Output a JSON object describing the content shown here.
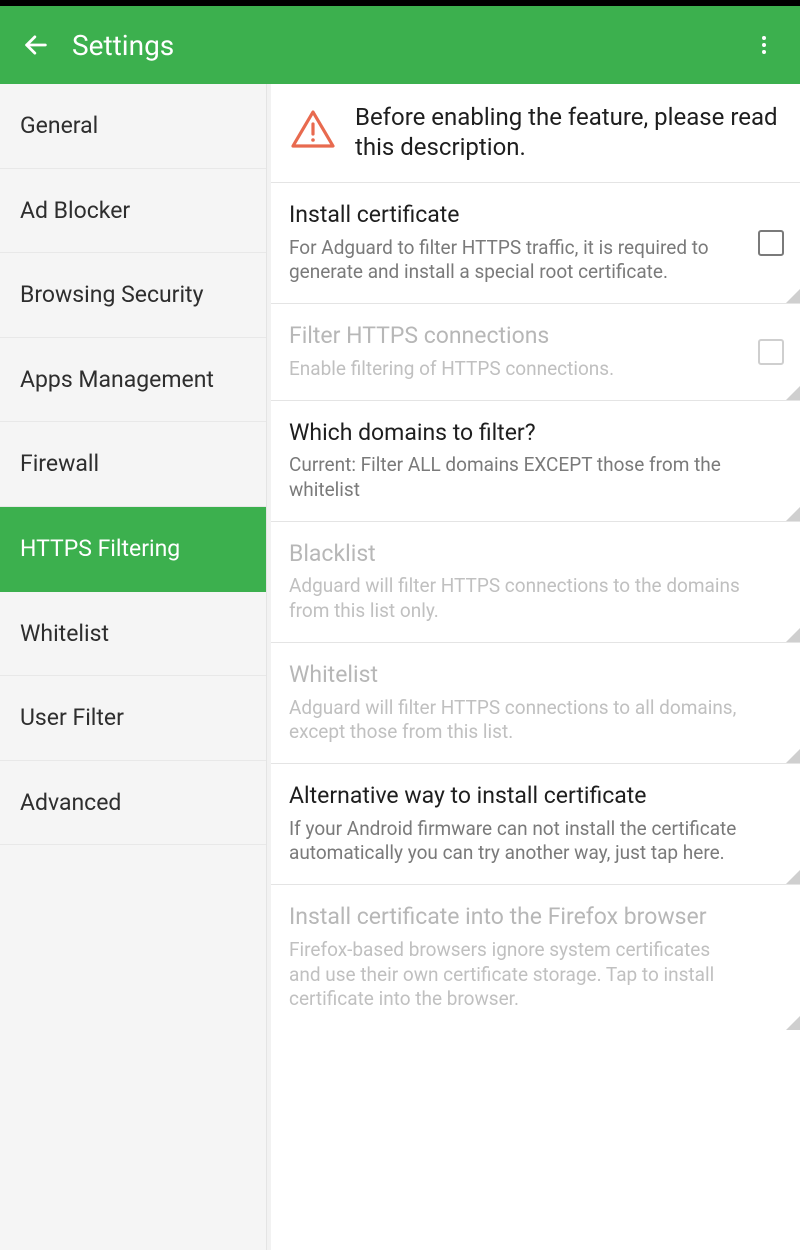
{
  "appbar": {
    "title": "Settings"
  },
  "sidebar": {
    "items": [
      {
        "label": "General"
      },
      {
        "label": "Ad Blocker"
      },
      {
        "label": "Browsing Security"
      },
      {
        "label": "Apps Management"
      },
      {
        "label": "Firewall"
      },
      {
        "label": "HTTPS Filtering"
      },
      {
        "label": "Whitelist"
      },
      {
        "label": "User Filter"
      },
      {
        "label": "Advanced"
      }
    ],
    "activeIndex": 5
  },
  "banner": {
    "message": "Before enabling the feature, please read this description."
  },
  "settings": [
    {
      "title": "Install certificate",
      "desc": "For Adguard to filter HTTPS traffic, it is required to generate and install a special root certificate.",
      "checkbox": true,
      "disabled": false
    },
    {
      "title": "Filter HTTPS connections",
      "desc": "Enable filtering of HTTPS connections.",
      "checkbox": true,
      "disabled": true
    },
    {
      "title": "Which domains to filter?",
      "desc": "Current: Filter ALL domains EXCEPT those from the whitelist",
      "checkbox": false,
      "disabled": false
    },
    {
      "title": "Blacklist",
      "desc": "Adguard will filter HTTPS connections to the domains from this list only.",
      "checkbox": false,
      "disabled": true
    },
    {
      "title": "Whitelist",
      "desc": "Adguard will filter HTTPS connections to all domains, except those from this list.",
      "checkbox": false,
      "disabled": true
    },
    {
      "title": "Alternative way to install certificate",
      "desc": "If your Android firmware can not install the certificate automatically you can try another way, just tap here.",
      "checkbox": false,
      "disabled": false
    },
    {
      "title": "Install certificate into the Firefox browser",
      "desc": "Firefox-based browsers ignore system certificates and use their own certificate storage. Tap to install certificate into the browser.",
      "checkbox": false,
      "disabled": true
    }
  ]
}
